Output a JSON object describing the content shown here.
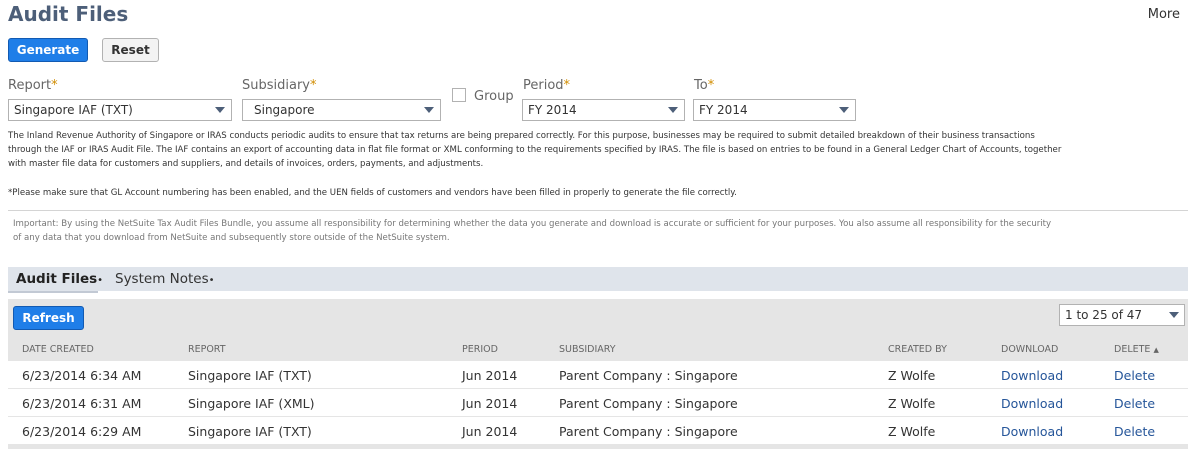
{
  "page": {
    "title": "Audit Files",
    "more_label": "More"
  },
  "actions": {
    "generate_label": "Generate",
    "reset_label": "Reset"
  },
  "form": {
    "report": {
      "label": "Report",
      "required_mark": "*",
      "value": "Singapore IAF (TXT)"
    },
    "subsidiary": {
      "label": "Subsidiary",
      "required_mark": "*",
      "value": "Singapore"
    },
    "group": {
      "label": "Group",
      "checked": false
    },
    "period": {
      "label": "Period",
      "required_mark": "*",
      "value": "FY 2014"
    },
    "to": {
      "label": "To",
      "required_mark": "*",
      "value": "FY 2014"
    }
  },
  "description": {
    "line1": "The Inland Revenue Authority of Singapore or IRAS conducts periodic audits to ensure that tax returns are being prepared correctly. For this purpose, businesses may be required to submit detailed breakdown of their business transactions",
    "line2": "through the IAF or IRAS Audit File. The IAF contains an export of accounting data in flat file format or XML conforming to the requirements specified by IRAS. The file is based on entries to be found in a General Ledger Chart of Accounts, together",
    "line3": "with master file data for customers and suppliers, and details of invoices, orders, payments, and adjustments.",
    "note": "*Please make sure that GL Account numbering has been enabled, and the UEN fields of customers and vendors have been filled in properly to generate the file correctly."
  },
  "important": {
    "line1": "Important: By using the NetSuite Tax Audit Files Bundle, you assume all responsibility for determining whether the data you generate and download is accurate or sufficient for your purposes. You also assume all responsibility for the security",
    "line2": "of any data that you download from NetSuite and subsequently store outside of the NetSuite system."
  },
  "tabs": [
    {
      "label": "Audit Files",
      "suffix": "•",
      "active": true
    },
    {
      "label": "System Notes",
      "suffix": "•",
      "active": false
    }
  ],
  "list": {
    "refresh_label": "Refresh",
    "pager_value": "1 to 25 of 47",
    "columns": {
      "date_created": "DATE CREATED",
      "report": "REPORT",
      "period": "PERIOD",
      "subsidiary": "SUBSIDIARY",
      "created_by": "CREATED BY",
      "download": "DOWNLOAD",
      "delete": "DELETE",
      "delete_sort": "▲"
    },
    "rows": [
      {
        "date_created": "6/23/2014 6:34 AM",
        "report": "Singapore IAF (TXT)",
        "period": "Jun 2014",
        "subsidiary": "Parent Company : Singapore",
        "created_by": "Z Wolfe",
        "download": "Download",
        "delete": "Delete"
      },
      {
        "date_created": "6/23/2014 6:31 AM",
        "report": "Singapore IAF (XML)",
        "period": "Jun 2014",
        "subsidiary": "Parent Company : Singapore",
        "created_by": "Z Wolfe",
        "download": "Download",
        "delete": "Delete"
      },
      {
        "date_created": "6/23/2014 6:29 AM",
        "report": "Singapore IAF (TXT)",
        "period": "Jun 2014",
        "subsidiary": "Parent Company : Singapore",
        "created_by": "Z Wolfe",
        "download": "Download",
        "delete": "Delete"
      }
    ]
  },
  "colors": {
    "primary": "#1f7ee8",
    "title": "#4d5f79",
    "link": "#255599",
    "required": "#d18d00",
    "tabbar": "#dfe4eb",
    "header_bg": "#e5e5e5"
  },
  "icons": {
    "dropdown": "chevron-down-icon",
    "sort": "sort-ascending-icon"
  }
}
